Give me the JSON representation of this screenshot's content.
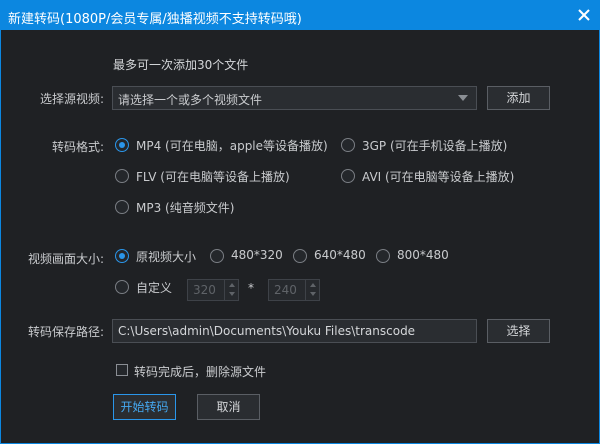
{
  "window": {
    "title": "新建转码(1080P/会员专属/独播视频不支持转码哦)",
    "close_icon": "close-icon"
  },
  "source": {
    "hint": "最多可一次添加30个文件",
    "label": "选择源视频:",
    "select_value": "请选择一个或多个视频文件",
    "add_label": "添加"
  },
  "format": {
    "label": "转码格式:",
    "options": [
      {
        "label": "MP4 (可在电脑，apple等设备播放)",
        "selected": true
      },
      {
        "label": "3GP  (可在手机设备上播放)",
        "selected": false
      },
      {
        "label": "FLV   (可在电脑等设备上播放)",
        "selected": false
      },
      {
        "label": "AVI   (可在电脑等设备上播放)",
        "selected": false
      },
      {
        "label": "MP3 (纯音频文件)",
        "selected": false
      }
    ]
  },
  "size": {
    "label": "视频画面大小:",
    "options": [
      {
        "label": "原视频大小",
        "selected": true
      },
      {
        "label": "480*320",
        "selected": false
      },
      {
        "label": "640*480",
        "selected": false
      },
      {
        "label": "800*480",
        "selected": false
      }
    ],
    "custom_label": "自定义",
    "custom_width": "320",
    "times": "*",
    "custom_height": "240"
  },
  "save": {
    "label": "转码保存路径:",
    "path": "C:\\Users\\admin\\Documents\\Youku Files\\transcode",
    "choose_label": "选择"
  },
  "delete_source": {
    "label": "转码完成后，删除源文件",
    "checked": false
  },
  "actions": {
    "start_label": "开始转码",
    "cancel_label": "取消"
  },
  "colors": {
    "accent": "#0c87e0",
    "background": "#1f2124"
  }
}
